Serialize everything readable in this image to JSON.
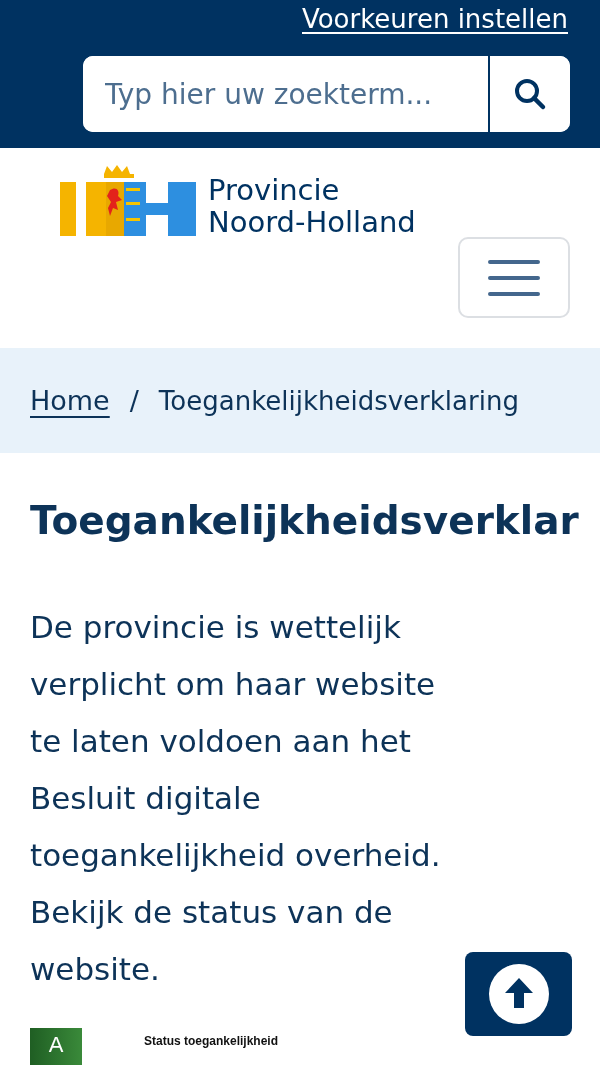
{
  "header": {
    "preferences_link": "Voorkeuren instellen",
    "search": {
      "placeholder": "Typ hier uw zoekterm..."
    }
  },
  "logo": {
    "lines": [
      "Provincie",
      "Noord-Holland"
    ]
  },
  "breadcrumb": [
    {
      "label": "Home",
      "link": true
    },
    {
      "label": "Toegankelijkheidsverklaring",
      "link": false
    }
  ],
  "breadcrumb_separator": "/",
  "heading": "Toegankelijkheidsverklar",
  "intro": "De provincie is wettelijk verplicht om haar website te laten voldoen aan het Besluit digitale toegankelijkheid overheid. Bekijk de status van de website.",
  "status_badge": {
    "grade": "A",
    "title": "Status toegankelijkheid"
  }
}
